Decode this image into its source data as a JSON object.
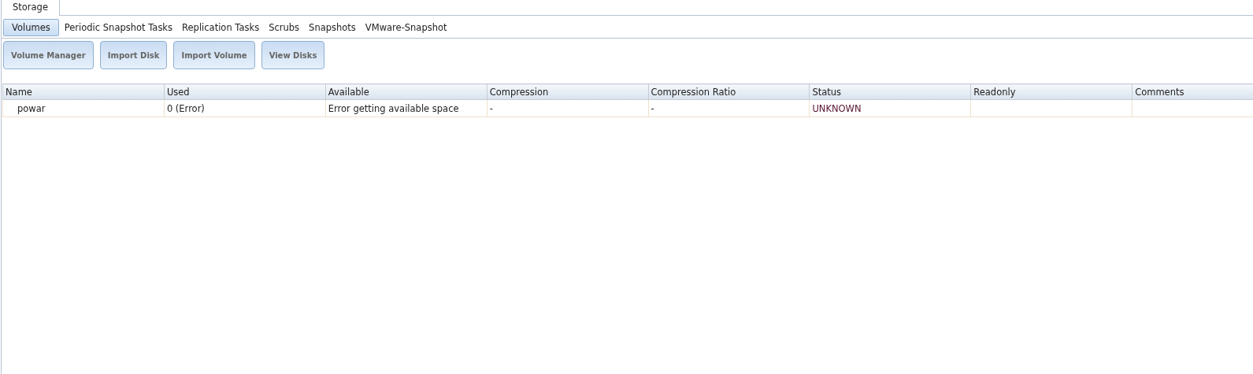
{
  "main_tabs": [
    {
      "label": "Storage",
      "selected": true
    }
  ],
  "sub_tabs": [
    {
      "label": "Volumes",
      "selected": true
    },
    {
      "label": "Periodic Snapshot Tasks",
      "selected": false
    },
    {
      "label": "Replication Tasks",
      "selected": false
    },
    {
      "label": "Scrubs",
      "selected": false
    },
    {
      "label": "Snapshots",
      "selected": false
    },
    {
      "label": "VMware-Snapshot",
      "selected": false
    }
  ],
  "buttons": [
    "Volume Manager",
    "Import Disk",
    "Import Volume",
    "View Disks"
  ],
  "table": {
    "columns": [
      {
        "label": "Name",
        "kind": "name"
      },
      {
        "label": "Used",
        "kind": "text"
      },
      {
        "label": "Available",
        "kind": "text"
      },
      {
        "label": "Compression",
        "kind": "text"
      },
      {
        "label": "Compression Ratio",
        "kind": "text"
      },
      {
        "label": "Status",
        "kind": "status"
      },
      {
        "label": "Readonly",
        "kind": "text"
      },
      {
        "label": "Comments",
        "kind": "text"
      }
    ],
    "rows": [
      {
        "cells": [
          "powar",
          "0 (Error)",
          "Error getting available space",
          "-",
          "-",
          "UNKNOWN",
          "",
          ""
        ]
      }
    ]
  }
}
